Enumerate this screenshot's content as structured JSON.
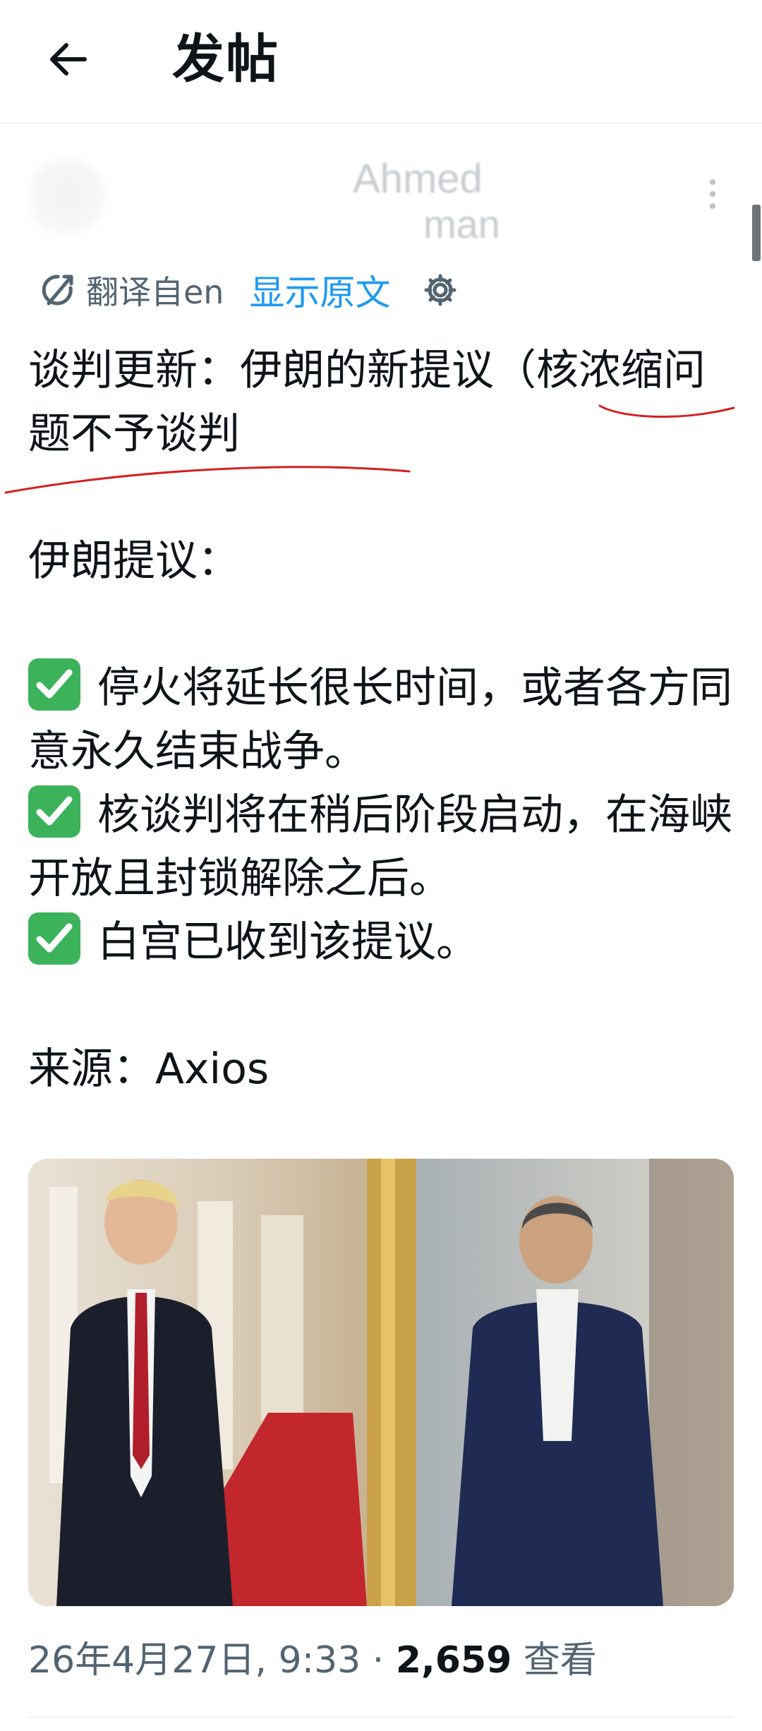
{
  "header": {
    "title": "发帖",
    "back_icon": "arrow-left-icon"
  },
  "author": {
    "display_name": "Ahmed",
    "username": "man"
  },
  "translation": {
    "translated_from": "翻译自en",
    "show_original": "显示原文",
    "settings_icon": "gear-icon"
  },
  "post": {
    "headline": "谈判更新：伊朗的新提议（核浓缩问题不予谈判",
    "proposal_label": "伊朗提议：",
    "items": [
      "停火将延长很长时间，或者各方同意永久结束战争。",
      "核谈判将在稍后阶段启动，在海峡开放且封锁解除之后。",
      "白宫已收到该提议。"
    ],
    "source": "来源：Axios"
  },
  "meta": {
    "timestamp": "26年4月27日, 9:33 · ",
    "views_count": "2,659",
    "views_label": " 查看"
  },
  "colors": {
    "accent": "#1d9bf0",
    "check": "#3cb35a",
    "annotation": "#d42020",
    "secondary_text": "#536471"
  }
}
